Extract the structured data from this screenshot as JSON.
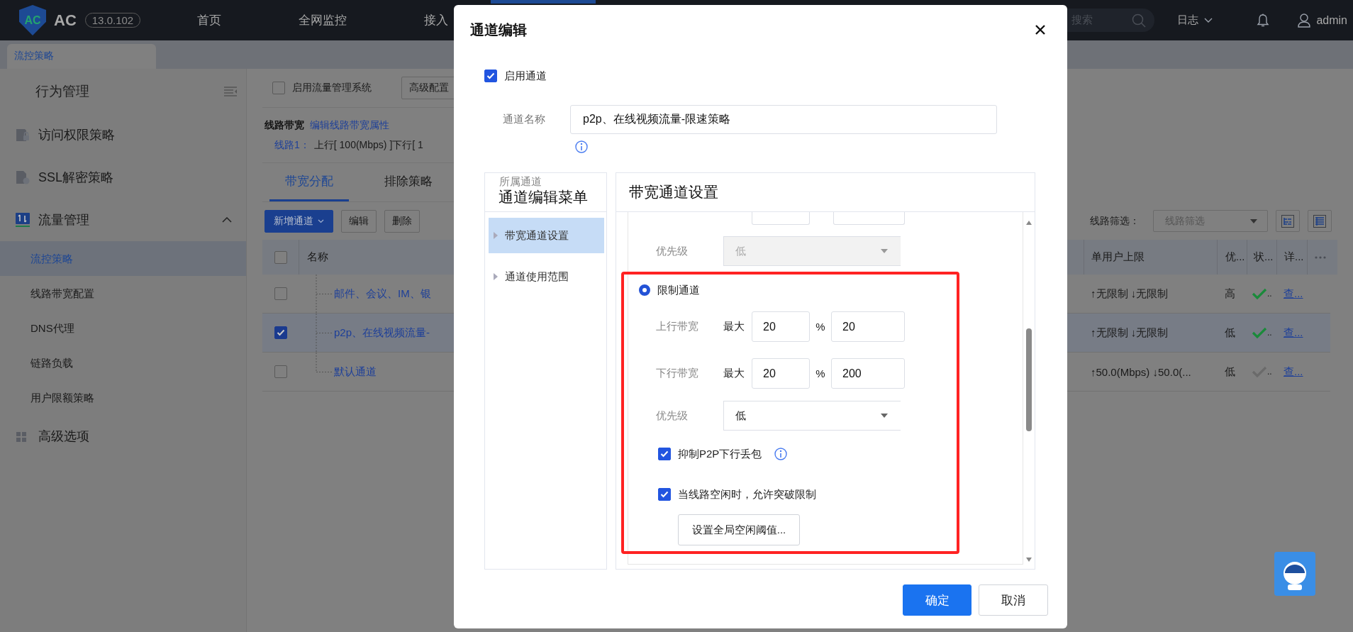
{
  "top_bar": {
    "logo_mark": "AC",
    "brand": "AC",
    "version": "13.0.102",
    "nav": [
      {
        "label": "首页"
      },
      {
        "label": "全网监控"
      },
      {
        "label": "接入"
      }
    ],
    "search": {
      "placeholder": "搜索"
    },
    "log_menu": "日志",
    "user": "admin"
  },
  "page_tabs": [
    {
      "label": "流控策略",
      "selected": true
    }
  ],
  "sidebar": {
    "title": "行为管理",
    "items": [
      {
        "label": "访问权限策略"
      },
      {
        "label": "SSL解密策略"
      },
      {
        "label": "流量管理",
        "expanded": true,
        "children": [
          {
            "label": "流控策略",
            "selected": true
          },
          {
            "label": "线路带宽配置",
            "selected": false
          },
          {
            "label": "DNS代理",
            "selected": false
          },
          {
            "label": "链路负载",
            "selected": false
          },
          {
            "label": "用户限额策略",
            "selected": false
          }
        ]
      },
      {
        "label": "高级选项"
      }
    ]
  },
  "main": {
    "enable_system": {
      "label": "启用流量管理系统",
      "checked": false
    },
    "advanced_button": "高级配置",
    "line_bandwidth": {
      "title": "线路带宽",
      "edit_link": "编辑线路带宽属性",
      "line_label": "线路1：",
      "line_value": "上行[ 100(Mbps) ]下行[ 1"
    },
    "tabs": [
      {
        "label": "带宽分配",
        "selected": true
      },
      {
        "label": "排除策略",
        "selected": false
      }
    ],
    "toolbar": {
      "buttons": [
        {
          "label": "新增通道",
          "kind": "primary"
        },
        {
          "label": "编辑",
          "kind": "default"
        },
        {
          "label": "删除",
          "kind": "default"
        }
      ],
      "filter_label": "线路筛选：",
      "filter_placeholder": "线路筛选"
    },
    "table": {
      "header_checked": false,
      "columns": [
        "名称",
        "单用户上限",
        "优...",
        "状...",
        "详..."
      ],
      "rows": [
        {
          "name": "邮件、会议、IM、银",
          "checked": false,
          "user_limit": "↑无限制 ↓无限制",
          "priority": "高",
          "enabled": true,
          "status_text": "..",
          "detail": "查..."
        },
        {
          "name": "p2p、在线视频流量-",
          "checked": true,
          "user_limit": "↑无限制 ↓无限制",
          "priority": "低",
          "enabled": true,
          "status_text": "..",
          "detail": "查..."
        },
        {
          "name": "默认通道",
          "checked": false,
          "user_limit": "↑50.0(Mbps) ↓50.0(...",
          "priority": "低",
          "enabled": false,
          "status_text": "..",
          "detail": "查..."
        }
      ]
    }
  },
  "dialog": {
    "title": "通道编辑",
    "enable": {
      "label": "启用通道",
      "checked": true
    },
    "name_field": {
      "label": "通道名称",
      "value": "p2p、在线视频流量-限速策略"
    },
    "parent_label": "所属通道",
    "menu": {
      "title": "通道编辑菜单",
      "items": [
        {
          "label": "带宽通道设置",
          "selected": true
        },
        {
          "label": "通道使用范围",
          "selected": false
        }
      ]
    },
    "settings": {
      "title": "带宽通道设置",
      "fixed_priority": {
        "label": "优先级",
        "value": "低",
        "disabled": true
      },
      "limit": {
        "label": "限制通道",
        "selected": true,
        "rates": [
          {
            "label": "上行带宽",
            "max_label": "最大",
            "percent": "20",
            "unit": "%",
            "value": "20"
          },
          {
            "label": "下行带宽",
            "max_label": "最大",
            "percent": "20",
            "unit": "%",
            "value": "200"
          }
        ],
        "priority": {
          "label": "优先级",
          "value": "低",
          "disabled": false
        },
        "options": [
          {
            "label": "抑制P2P下行丢包",
            "checked": true,
            "info": true
          },
          {
            "label": "当线路空闲时，允许突破限制",
            "checked": true
          }
        ],
        "threshold_button": "设置全局空闲阈值..."
      }
    },
    "buttons": [
      {
        "label": "确定",
        "kind": "primary"
      },
      {
        "label": "取消",
        "kind": "default"
      }
    ]
  }
}
